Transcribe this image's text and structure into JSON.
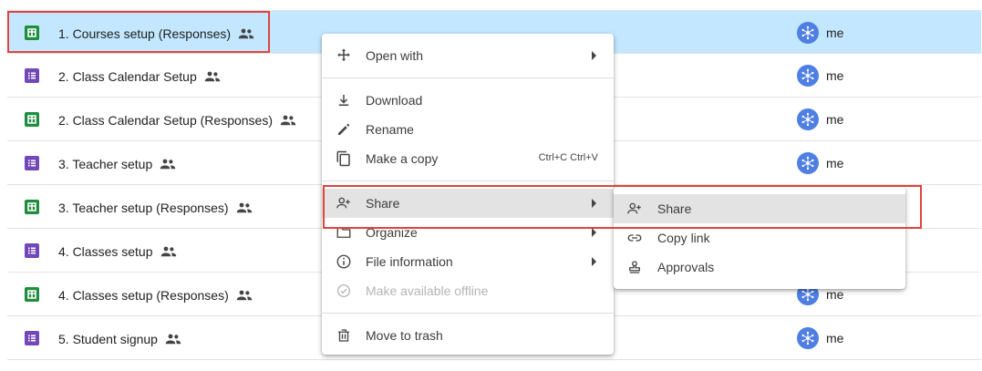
{
  "files": [
    {
      "name": "1. Courses setup (Responses)",
      "type": "sheets",
      "owner": "me",
      "selected": true
    },
    {
      "name": "2. Class Calendar Setup",
      "type": "forms",
      "owner": "me"
    },
    {
      "name": "2. Class Calendar Setup (Responses)",
      "type": "sheets",
      "owner": "me"
    },
    {
      "name": "3. Teacher setup",
      "type": "forms",
      "owner": "me"
    },
    {
      "name": "3. Teacher setup (Responses)",
      "type": "sheets",
      "owner": ""
    },
    {
      "name": "4. Classes setup",
      "type": "forms",
      "owner": ""
    },
    {
      "name": "4. Classes setup (Responses)",
      "type": "sheets",
      "owner": "me"
    },
    {
      "name": "5. Student signup",
      "type": "forms",
      "owner": "me"
    }
  ],
  "context_menu": {
    "open_with": "Open with",
    "download": "Download",
    "rename": "Rename",
    "make_copy": "Make a copy",
    "make_copy_shortcut": "Ctrl+C Ctrl+V",
    "share": "Share",
    "organize": "Organize",
    "file_information": "File information",
    "make_offline": "Make available offline",
    "move_to_trash": "Move to trash"
  },
  "share_submenu": {
    "share": "Share",
    "copy_link": "Copy link",
    "approvals": "Approvals"
  },
  "colors": {
    "selected_row": "#c2e7ff",
    "sheets_green": "#1e8e3e",
    "forms_purple": "#7248b9",
    "highlight_red": "#e0443e",
    "avatar_blue": "#4f7fe2"
  },
  "icons": {
    "open_with": "move-arrows-icon",
    "download": "download-icon",
    "rename": "pencil-icon",
    "make_copy": "copy-icon",
    "share": "person-add-icon",
    "organize": "folder-icon",
    "file_information": "info-icon",
    "make_offline": "offline-check-icon",
    "move_to_trash": "trash-icon",
    "copy_link": "link-icon",
    "approvals": "stamp-icon"
  }
}
